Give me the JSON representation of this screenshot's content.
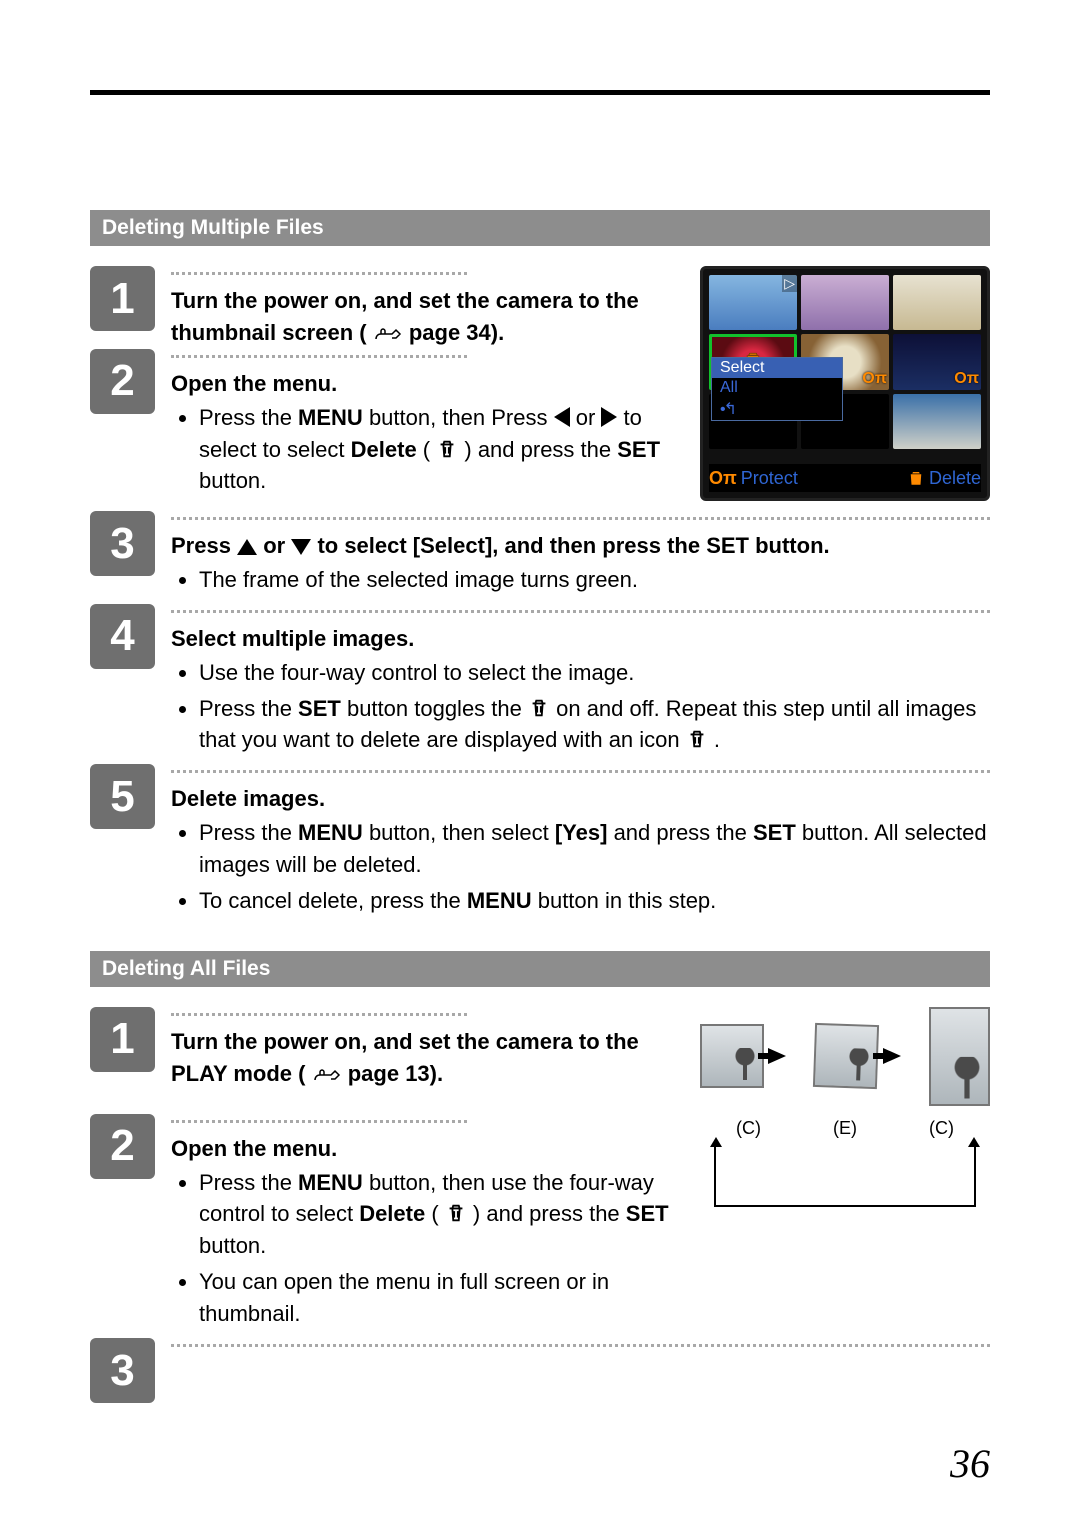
{
  "page_number": "36",
  "section1": {
    "title": "Deleting Multiple Files",
    "steps": {
      "s1": {
        "title_a": "Turn the power on, and set the camera to the thumbnail screen (",
        "title_b": "page 34)."
      },
      "s2": {
        "title": "Open the menu.",
        "bullet1a": "Press the ",
        "bullet1b": "MENU",
        "bullet1c": " button, then Press ",
        "bullet1d": " or ",
        "bullet1e": " to select to select ",
        "bullet1f": "Delete",
        "bullet1g": " ( ",
        "bullet1h": " ) and press the ",
        "bullet1i": "SET",
        "bullet1j": " button."
      },
      "s3": {
        "title_a": "Press ",
        "title_b": " or ",
        "title_c": " to select [Select], and then press the SET button.",
        "bullet1": "The frame of the selected image turns green."
      },
      "s4": {
        "title": "Select multiple images.",
        "bullet1": "Use the four-way control to select the image.",
        "bullet2a": "Press the ",
        "bullet2b": "SET",
        "bullet2c": " button toggles the ",
        "bullet2d": " on and off. Repeat this step until all images that you want to delete are displayed with an icon ",
        "bullet2e": "."
      },
      "s5": {
        "title": "Delete images.",
        "bullet1a": "Press the ",
        "bullet1b": "MENU",
        "bullet1c": " button, then select ",
        "bullet1d": "[Yes]",
        "bullet1e": " and press the ",
        "bullet1f": "SET",
        "bullet1g": " button. All selected images will be deleted.",
        "bullet2a": "To cancel delete, press the ",
        "bullet2b": "MENU",
        "bullet2c": " button in this step."
      }
    },
    "lcd": {
      "menu": {
        "opt1": "Select",
        "opt2": "All",
        "opt3_icon": "↩"
      },
      "protect": "Protect",
      "delete": "Delete"
    }
  },
  "section2": {
    "title": "Deleting All Files",
    "steps": {
      "s1": {
        "title_a": "Turn the power on, and set the camera to the PLAY mode (",
        "title_b": "page 13)."
      },
      "s2": {
        "title": "Open the menu.",
        "bullet1a": "Press the ",
        "bullet1b": "MENU",
        "bullet1c": " button, then use the four-way control to select ",
        "bullet1d": "Delete",
        "bullet1e": " ( ",
        "bullet1f": " ) and press the ",
        "bullet1g": "SET",
        "bullet1h": " button.",
        "bullet2": "You can open the menu in full screen or in thumbnail."
      }
    },
    "rotate_labels": {
      "c1": "(C)",
      "e": "(E)",
      "c2": "(C)"
    }
  }
}
